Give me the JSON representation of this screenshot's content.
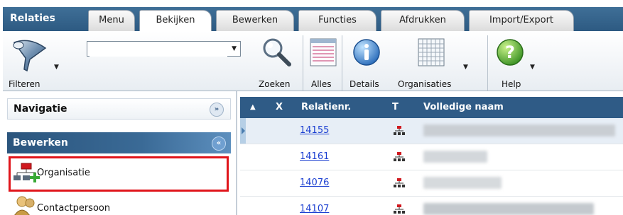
{
  "app": {
    "title": "Relaties"
  },
  "tabs": [
    {
      "label": "Menu",
      "active": false
    },
    {
      "label": "Bekijken",
      "active": true
    },
    {
      "label": "Bewerken",
      "active": false
    },
    {
      "label": "Functies",
      "active": false
    },
    {
      "label": "Afdrukken",
      "active": false
    },
    {
      "label": "Import/Export",
      "active": false
    }
  ],
  "ribbon": {
    "filter_label": "Filteren",
    "search_combo_value": "",
    "search_label": "Zoeken",
    "all_label": "Alles",
    "details_label": "Details",
    "organisations_label": "Organisaties",
    "help_label": "Help"
  },
  "navigation": {
    "header": "Navigatie",
    "edit_section": "Bewerken",
    "items": [
      {
        "label": "Organisatie",
        "icon": "add-organisation-icon"
      },
      {
        "label": "Contactpersoon",
        "icon": "contact-person-icon"
      }
    ]
  },
  "grid": {
    "columns": {
      "sort": "▲",
      "x": "X",
      "relation_number": "Relatienr.",
      "type": "T",
      "full_name": "Volledige naam"
    },
    "rows": [
      {
        "relation_number": "14155",
        "selected": true
      },
      {
        "relation_number": "14161",
        "selected": false
      },
      {
        "relation_number": "14076",
        "selected": false
      },
      {
        "relation_number": "14107",
        "selected": false
      }
    ]
  },
  "colors": {
    "header_blue": "#2f5b86",
    "link_blue": "#1b3fd1",
    "highlight_red": "#e0151b",
    "org_icon_red": "#d0191f"
  }
}
